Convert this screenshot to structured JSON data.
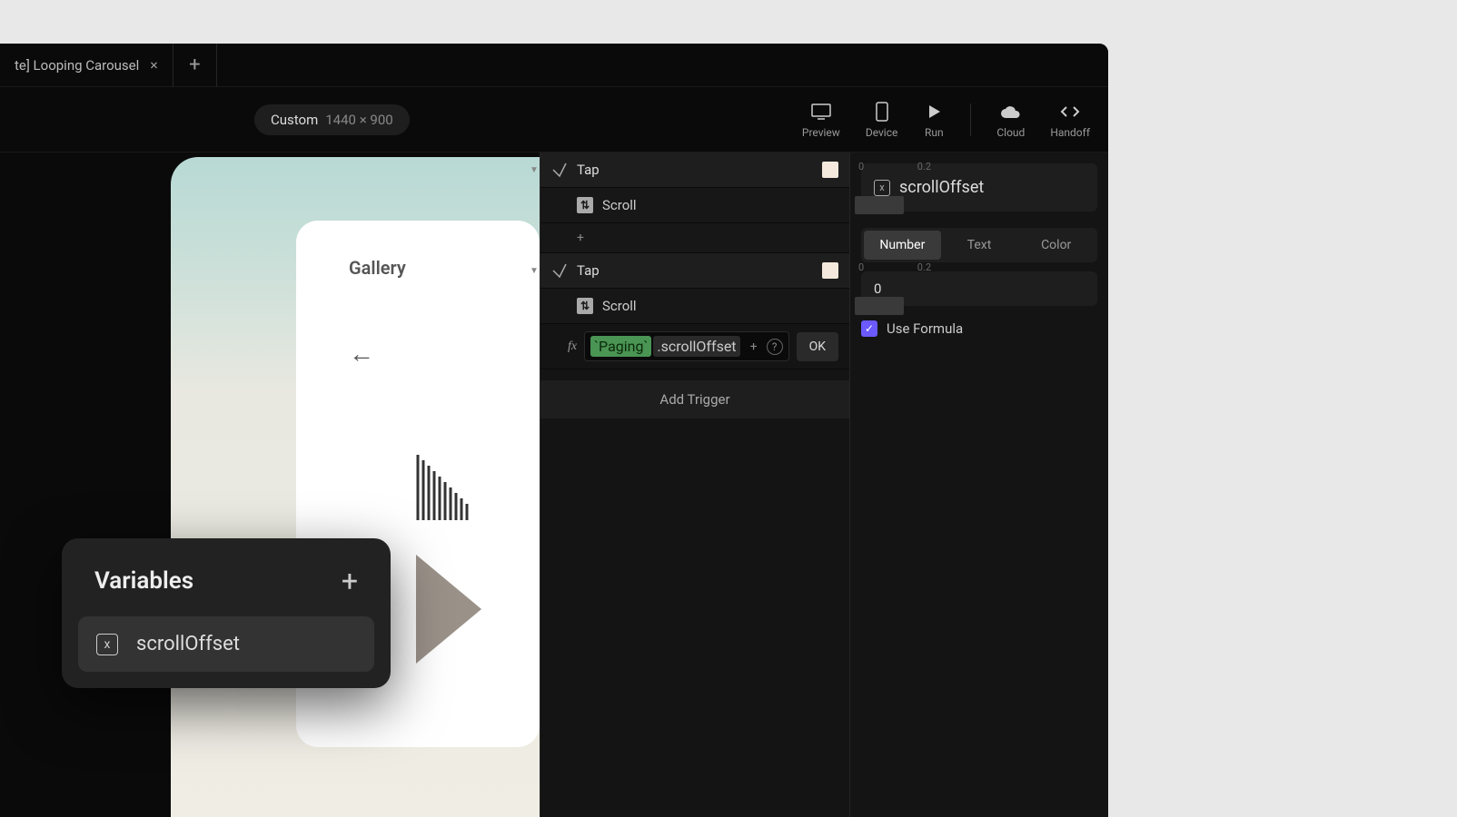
{
  "tab": {
    "title": "te] Looping Carousel"
  },
  "toolbar": {
    "size_label": "Custom",
    "size_dim": "1440 × 900",
    "preview": "Preview",
    "device": "Device",
    "run": "Run",
    "cloud": "Cloud",
    "handoff": "Handoff"
  },
  "canvas": {
    "gallery_title": "Gallery"
  },
  "triggers": {
    "tap1": "Tap",
    "scroll1": "Scroll",
    "tap2": "Tap",
    "scroll2": "Scroll",
    "add_trigger": "Add Trigger",
    "tick0": "0",
    "tick1": "0.2"
  },
  "formula": {
    "token": "`Paging`",
    "prop": ".scrollOffset",
    "ok": "OK"
  },
  "inspector": {
    "var_name": "scrollOffset",
    "tab_number": "Number",
    "tab_text": "Text",
    "tab_color": "Color",
    "value": "0",
    "use_formula": "Use Formula"
  },
  "popup": {
    "title": "Variables",
    "item1": "scrollOffset"
  }
}
